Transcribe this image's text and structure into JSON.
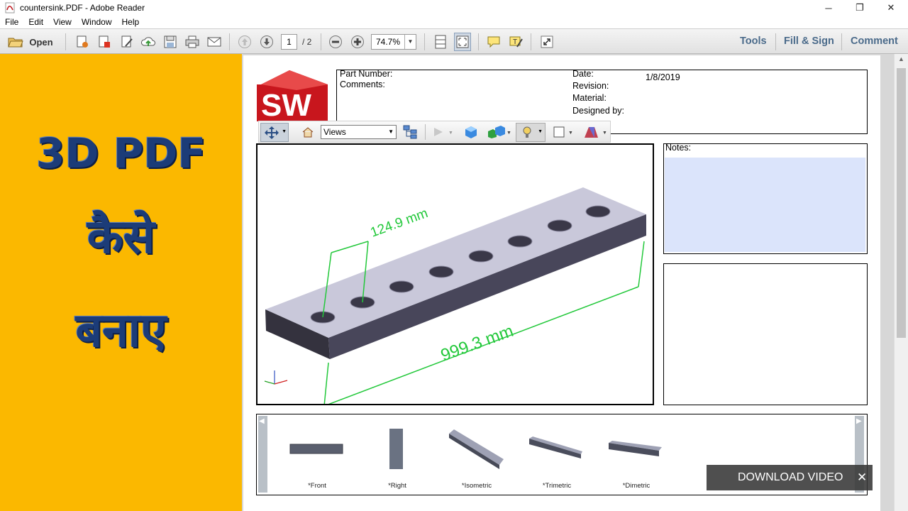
{
  "window": {
    "title": "countersink.PDF - Adobe Reader",
    "controls": {
      "minimize": "─",
      "restore": "❐",
      "close": "✕"
    }
  },
  "menu": [
    "File",
    "Edit",
    "View",
    "Window",
    "Help"
  ],
  "toolbar": {
    "open_label": "Open",
    "page_current": "1",
    "page_total": "/ 2",
    "zoom": "74.7%",
    "tools": "Tools",
    "fill_sign": "Fill & Sign",
    "comment": "Comment"
  },
  "overlay": {
    "line1": "3D PDF",
    "line2": "कैसे",
    "line3": "बनाए"
  },
  "document": {
    "logo": "SW",
    "part_number_label": "Part Number:",
    "comments_label": "Comments:",
    "date_label": "Date:",
    "date_value": "1/8/2019",
    "revision_label": "Revision:",
    "material_label": "Material:",
    "designed_by_label": "Designed by:",
    "notes_label": "Notes:",
    "views_select": "Views",
    "dim_width": "124.9 mm",
    "dim_length": "999.3 mm",
    "view_thumbs": [
      "*Front",
      "*Right",
      "*Isometric",
      "*Trimetric",
      "*Dimetric"
    ]
  },
  "download_bar": {
    "label": "DOWNLOAD VIDEO",
    "close": "✕"
  },
  "colors": {
    "overlay_bg": "#fbb800",
    "overlay_text": "#1c3c78",
    "dimension_green": "#22c83a",
    "part_face": "#c9c8da",
    "notes_fill": "#dbe4fb"
  }
}
